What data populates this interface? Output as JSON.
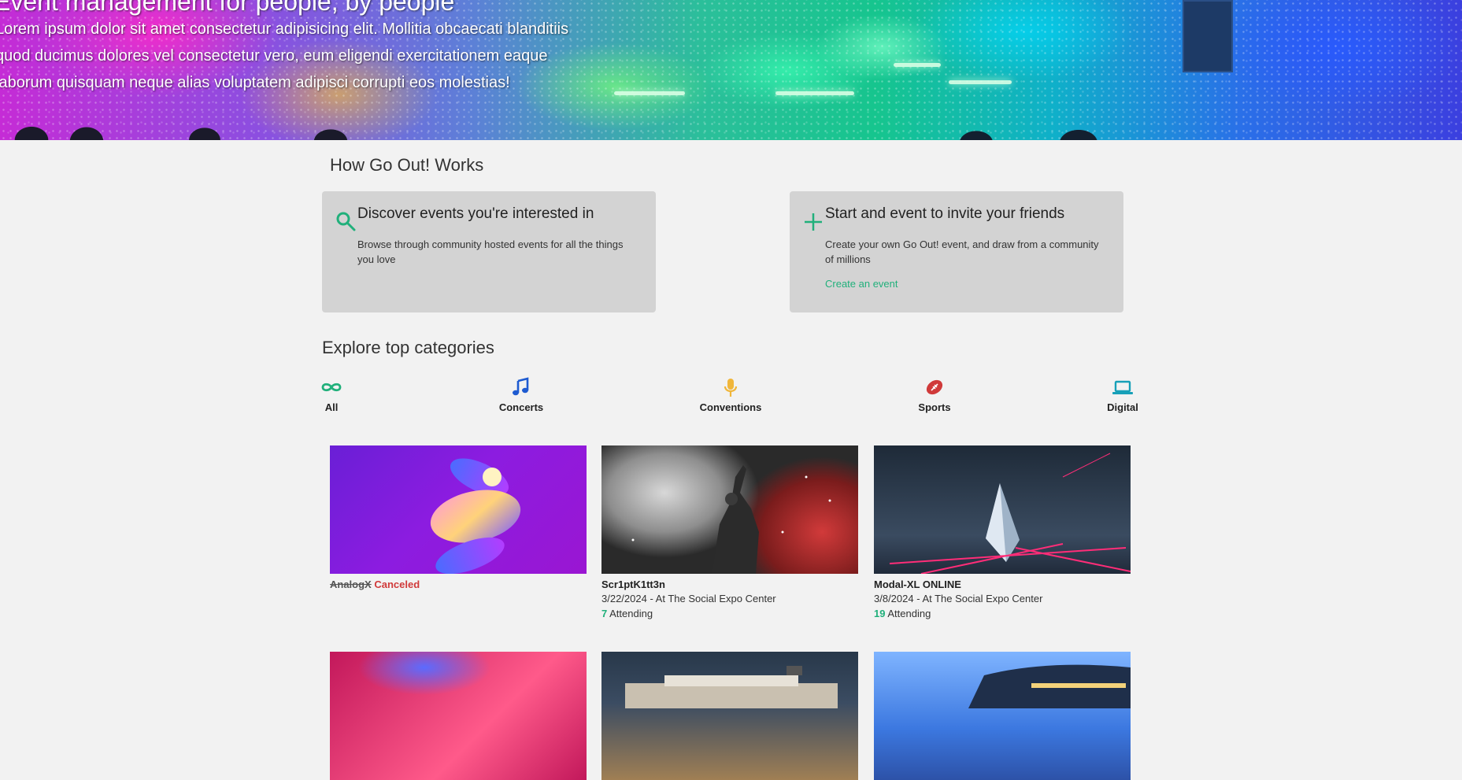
{
  "hero": {
    "title": "Event management for people, by people",
    "body": "Lorem ipsum dolor sit amet consectetur adipisicing elit. Mollitia obcaecati blanditiis quod ducimus dolores vel consectetur vero, eum eligendi exercitationem eaque laborum quisquam neque alias voluptatem adipisci corrupti eos molestias!"
  },
  "how": {
    "title": "How Go Out! Works",
    "cards": [
      {
        "icon": "search-icon",
        "title": "Discover events you're interested in",
        "text": "Browse through community hosted events for all the things you love",
        "link": ""
      },
      {
        "icon": "plus-icon",
        "title": "Start and event to invite your friends",
        "text": "Create your own Go Out! event, and draw from a community of millions",
        "link": "Create an event"
      }
    ]
  },
  "categories": {
    "title": "Explore top categories",
    "items": [
      {
        "label": "All",
        "icon": "infinity-icon",
        "color": "#21b07b"
      },
      {
        "label": "Concerts",
        "icon": "music-note-icon",
        "color": "#1e5bd1"
      },
      {
        "label": "Conventions",
        "icon": "microphone-icon",
        "color": "#f0b63a"
      },
      {
        "label": "Sports",
        "icon": "football-icon",
        "color": "#d03a3a"
      },
      {
        "label": "Digital",
        "icon": "laptop-icon",
        "color": "#17a0b8"
      }
    ]
  },
  "events": [
    {
      "title": "AnalogX",
      "status": "Canceled",
      "date_location": "",
      "attending_count": "",
      "attending_label": ""
    },
    {
      "title": "Scr1ptK1tt3n",
      "status": "",
      "date_location": "3/22/2024 - At The Social Expo Center",
      "attending_count": "7",
      "attending_label": " Attending"
    },
    {
      "title": "Modal-XL ONLINE",
      "status": "",
      "date_location": "3/8/2024 - At The Social Expo Center",
      "attending_count": "19",
      "attending_label": " Attending"
    },
    {
      "title": "",
      "status": "",
      "date_location": "",
      "attending_count": "",
      "attending_label": ""
    },
    {
      "title": "",
      "status": "",
      "date_location": "",
      "attending_count": "",
      "attending_label": ""
    },
    {
      "title": "",
      "status": "",
      "date_location": "",
      "attending_count": "",
      "attending_label": ""
    }
  ],
  "colors": {
    "accent": "#21b07b",
    "cancel": "#d03a3a",
    "card_bg": "#d3d3d3",
    "page_bg": "#f2f2f2"
  }
}
